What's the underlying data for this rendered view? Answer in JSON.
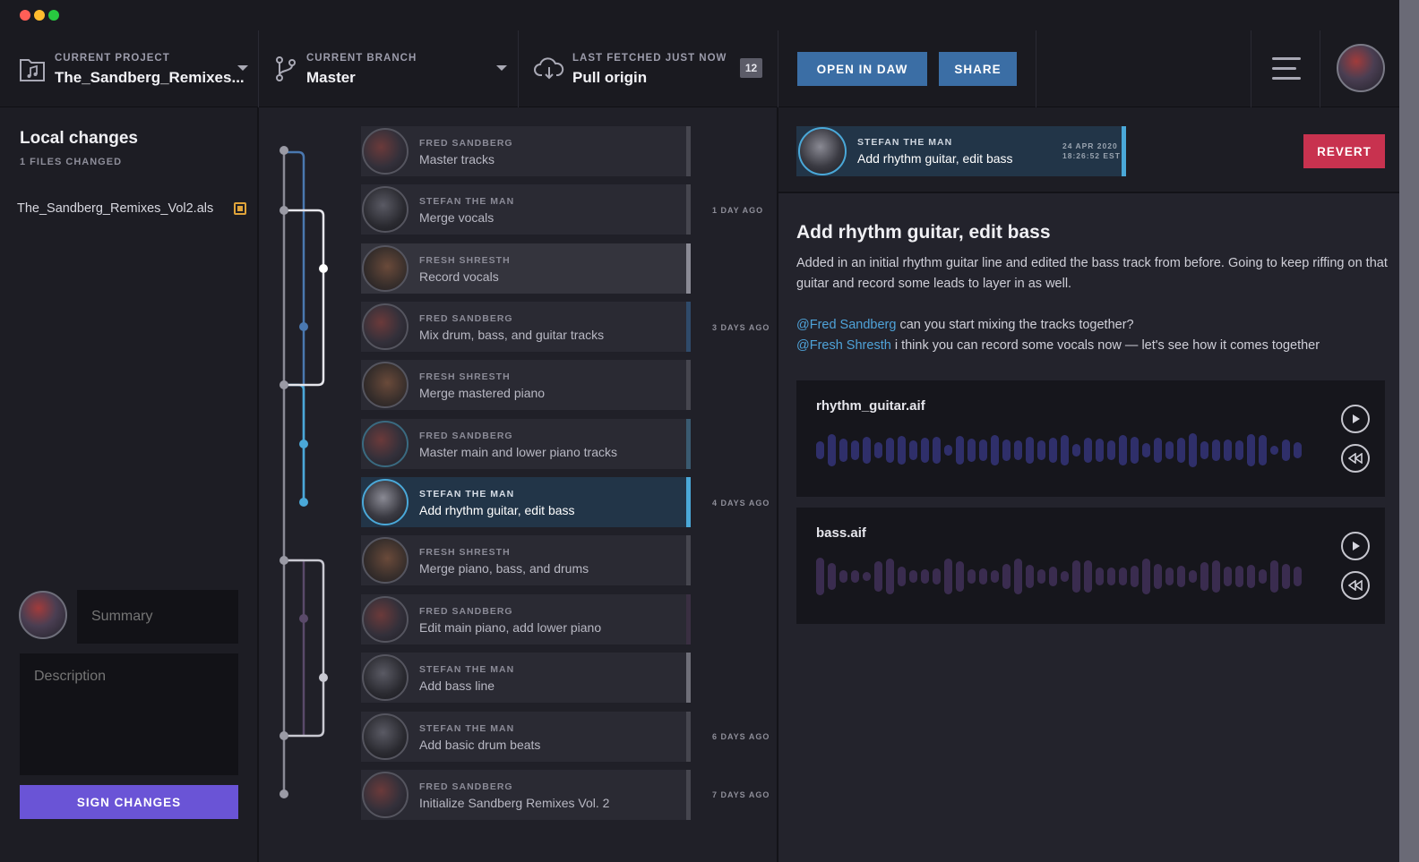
{
  "window": {
    "lights": {
      "close": "#ff5f57",
      "minimize": "#febc2e",
      "maximize": "#28c840"
    }
  },
  "header": {
    "project": {
      "label": "CURRENT PROJECT",
      "value": "The_Sandberg_Remixes..."
    },
    "branch": {
      "label": "CURRENT BRANCH",
      "value": "Master"
    },
    "fetch": {
      "label": "LAST FETCHED JUST NOW",
      "value": "Pull origin",
      "badge": "12"
    },
    "open_in_daw": "OPEN IN DAW",
    "share": "SHARE"
  },
  "local_changes": {
    "title": "Local changes",
    "subtitle": "1 FILES CHANGED",
    "files": [
      "The_Sandberg_Remixes_Vol2.als"
    ],
    "summary_placeholder": "Summary",
    "description_placeholder": "Description",
    "sign_button": "SIGN CHANGES"
  },
  "commits": [
    {
      "author": "FRED SANDBERG",
      "message": "Master tracks",
      "ago": ""
    },
    {
      "author": "STEFAN THE MAN",
      "message": "Merge vocals",
      "ago": "1 DAY AGO"
    },
    {
      "author": "FRESH SHRESTH",
      "message": "Record vocals",
      "ago": ""
    },
    {
      "author": "FRED SANDBERG",
      "message": "Mix drum, bass, and guitar tracks",
      "ago": "3 DAYS AGO"
    },
    {
      "author": "FRESH SHRESTH",
      "message": "Merge mastered piano",
      "ago": ""
    },
    {
      "author": "FRED SANDBERG",
      "message": "Master main and lower piano tracks",
      "ago": ""
    },
    {
      "author": "STEFAN THE MAN",
      "message": "Add rhythm guitar, edit bass",
      "ago": "4 DAYS AGO"
    },
    {
      "author": "FRESH SHRESTH",
      "message": "Merge piano, bass, and drums",
      "ago": ""
    },
    {
      "author": "FRED SANDBERG",
      "message": "Edit main piano, add lower piano",
      "ago": ""
    },
    {
      "author": "STEFAN THE MAN",
      "message": "Add bass line",
      "ago": ""
    },
    {
      "author": "STEFAN THE MAN",
      "message": "Add basic drum beats",
      "ago": "6 DAYS AGO"
    },
    {
      "author": "FRED SANDBERG",
      "message": "Initialize Sandberg Remixes Vol. 2",
      "ago": "7 DAYS AGO"
    }
  ],
  "selected_commit": {
    "author": "STEFAN THE MAN",
    "message": "Add rhythm guitar, edit bass",
    "date": "24 APR 2020",
    "time": "18:26:52 EST",
    "revert": "REVERT",
    "title": "Add rhythm guitar, edit bass",
    "body_line1": "Added in an initial rhythm guitar line and edited the bass track from before. Going to keep riffing on that",
    "body_line2": "guitar and record some leads to layer in as well.",
    "mention1": "@Fred Sandberg",
    "mention1_text": " can you start mixing the tracks together?",
    "mention2": "@Fresh Shresth",
    "mention2_text": " i think you can record some vocals now — let's see how it comes together"
  },
  "audio_files": [
    {
      "name": "rhythm_guitar.aif",
      "color": "#2f2f6a"
    },
    {
      "name": "bass.aif",
      "color": "#3a2c4f"
    }
  ],
  "colors": {
    "accent_blue": "#3b6ea5",
    "revert_red": "#c8324f",
    "sign_purple": "#6a54d6",
    "mention": "#4fa3d9",
    "graph_blue": "#4aa8d8"
  }
}
